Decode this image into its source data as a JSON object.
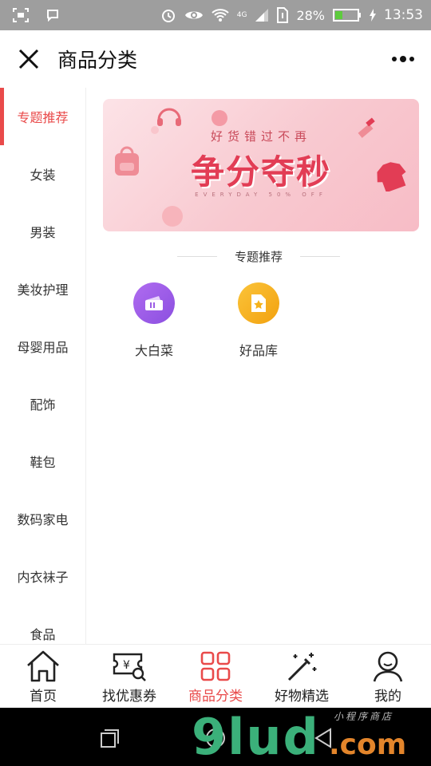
{
  "status_bar": {
    "battery_percent": "28%",
    "time": "13:53",
    "network": "4G",
    "icons": [
      "screenshot-icon",
      "chat-icon",
      "alarm-icon",
      "eye-icon",
      "wifi-icon",
      "signal-icon",
      "sim-icon",
      "battery-icon",
      "charging-icon"
    ]
  },
  "header": {
    "title": "商品分类",
    "close_icon": "close-icon",
    "more_icon": "more-icon"
  },
  "sidebar": {
    "active_index": 0,
    "items": [
      {
        "label": "专题推荐"
      },
      {
        "label": "女装"
      },
      {
        "label": "男装"
      },
      {
        "label": "美妆护理"
      },
      {
        "label": "母婴用品"
      },
      {
        "label": "配饰"
      },
      {
        "label": "鞋包"
      },
      {
        "label": "数码家电"
      },
      {
        "label": "内衣袜子"
      },
      {
        "label": "食品"
      }
    ]
  },
  "banner": {
    "top_text": "好货错过不再",
    "main_text": "争分夺秒",
    "sub_text": "EVERYDAY 50% OFF"
  },
  "section": {
    "title": "专题推荐",
    "items": [
      {
        "label": "大白菜",
        "icon": "ticket-icon",
        "color": "#9b5de5"
      },
      {
        "label": "好品库",
        "icon": "star-document-icon",
        "color": "#f5b21a"
      }
    ]
  },
  "tabbar": {
    "active_index": 2,
    "tabs": [
      {
        "label": "首页",
        "icon": "home-icon"
      },
      {
        "label": "找优惠券",
        "icon": "coupon-search-icon"
      },
      {
        "label": "商品分类",
        "icon": "grid-icon"
      },
      {
        "label": "好物精选",
        "icon": "magic-wand-icon"
      },
      {
        "label": "我的",
        "icon": "user-icon"
      }
    ]
  },
  "colors": {
    "accent": "#e94a4a",
    "status_bar": "#9e9e9e"
  },
  "watermark": {
    "main": "9lud",
    "domain": ".com",
    "tagline": "小程序商店"
  }
}
